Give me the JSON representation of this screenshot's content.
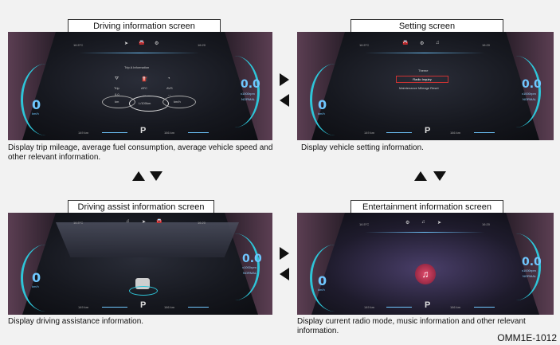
{
  "panels": {
    "driving_info": {
      "title": "Driving information screen",
      "desc": "Display trip mileage, average fuel consumption, average vehicle speed and other relevant information.",
      "temp": "16.5°C",
      "clock": "16:20",
      "menu_title": "Trip A Information",
      "stats": [
        {
          "label": "Trip",
          "value": "0.0",
          "unit": "km"
        },
        {
          "label": "AFC",
          "value": "-.-",
          "unit": "L/100km"
        },
        {
          "label": "AVS",
          "value": "-.-",
          "unit": "km/h"
        }
      ],
      "speed": "0",
      "speed_unit": "km/h",
      "rpm": "0.0",
      "rpm_unit": "x1000rpm",
      "rpm_status": "NORMAL",
      "gear": "P",
      "odo_left": "149 km",
      "odo_right": "166 km"
    },
    "setting": {
      "title": "Setting screen",
      "desc": "Display vehicle setting information.",
      "temp": "16.5°C",
      "clock": "16:20",
      "menu_items": [
        "Theme",
        "Radio Inquiry",
        "Maintenance Mileage Reset"
      ],
      "speed": "0",
      "speed_unit": "km/h",
      "rpm": "0.0",
      "rpm_unit": "x1000rpm",
      "rpm_status": "NORMAL",
      "gear": "P",
      "odo_left": "149 km",
      "odo_right": "166 km"
    },
    "driving_assist": {
      "title": "Driving assist information screen",
      "desc": "Display driving assistance information.",
      "temp": "16.5°C",
      "clock": "16:20",
      "speed": "0",
      "speed_unit": "km/h",
      "rpm": "0.0",
      "rpm_unit": "x1000rpm",
      "rpm_status": "NORMAL",
      "gear": "P",
      "odo_left": "149 km",
      "odo_right": "166 km"
    },
    "entertainment": {
      "title": "Entertainment information screen",
      "desc": "Display current radio mode, music information and other relevant information.",
      "temp": "16.5°C",
      "clock": "16:20",
      "speed": "0",
      "speed_unit": "km/h",
      "rpm": "0.0",
      "rpm_unit": "x1000rpm",
      "rpm_status": "NORMAL",
      "gear": "P",
      "odo_left": "149 km",
      "odo_right": "166 km"
    }
  },
  "icons": {
    "nav": "➤",
    "car": "🚘",
    "settings": "⚙",
    "music": "♫"
  },
  "figure_code": "OMM1E-1012",
  "colors": {
    "accent": "#2ec5d8",
    "digits": "#6fc7ff",
    "music": "#e04a6a"
  }
}
